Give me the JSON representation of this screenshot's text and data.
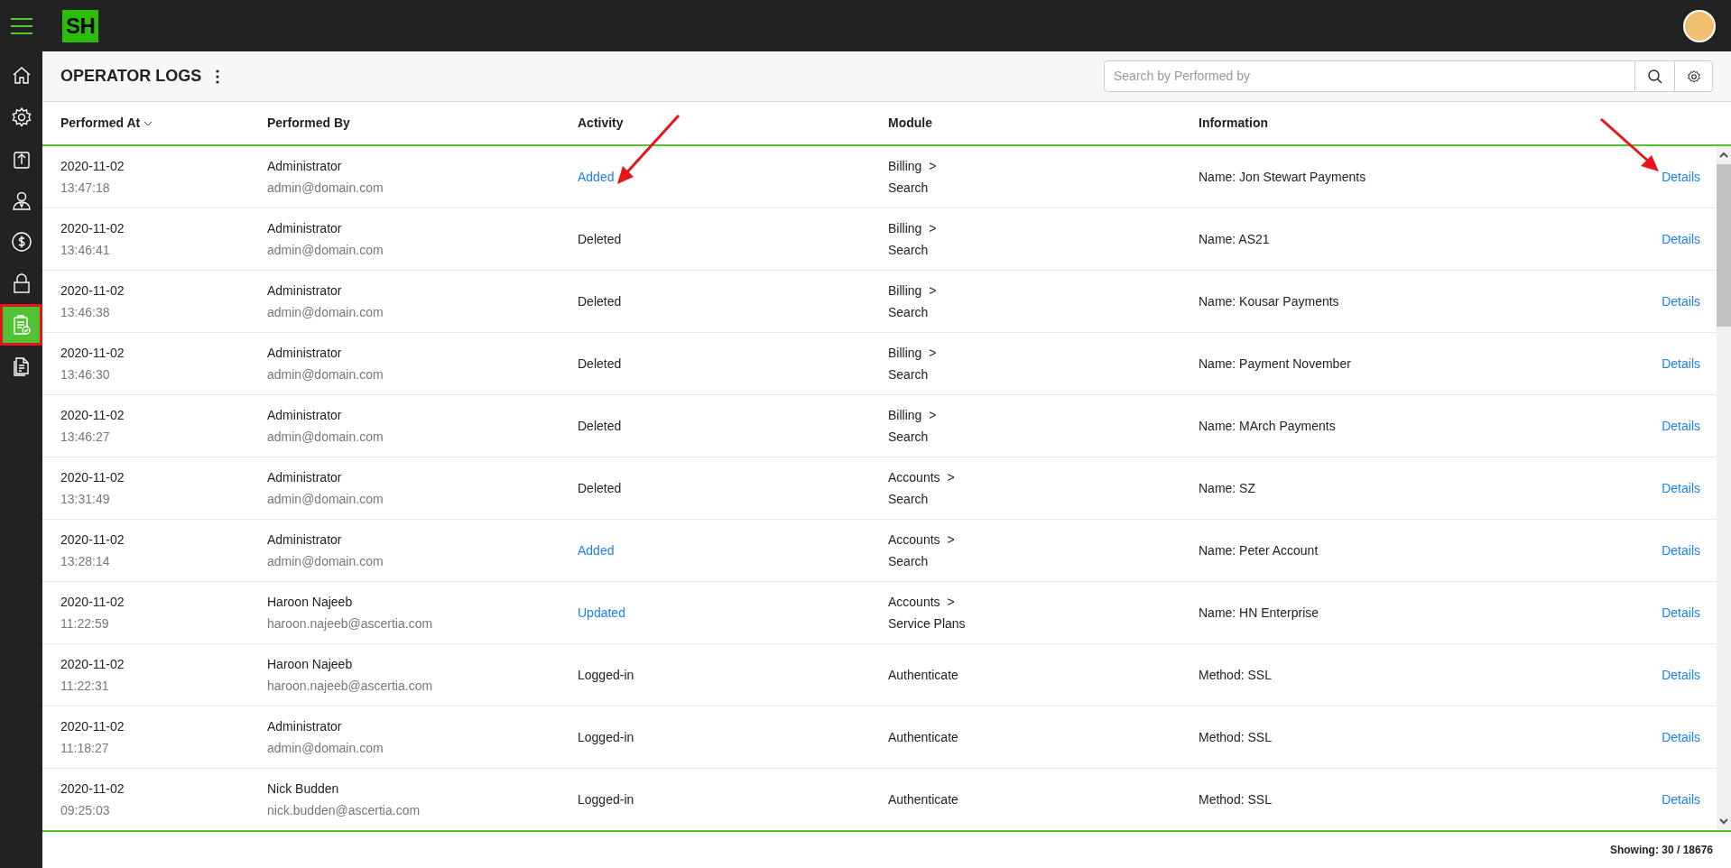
{
  "app": {
    "logo": "SH"
  },
  "sidebar": {
    "items": [
      {
        "kind": "home",
        "selected": false
      },
      {
        "kind": "settings",
        "selected": false
      },
      {
        "kind": "upload",
        "selected": false
      },
      {
        "kind": "user",
        "selected": false
      },
      {
        "kind": "dollar",
        "selected": false
      },
      {
        "kind": "lock",
        "selected": false
      },
      {
        "kind": "clipboard",
        "selected": true
      },
      {
        "kind": "document",
        "selected": false
      }
    ]
  },
  "page": {
    "title": "OPERATOR LOGS",
    "search": {
      "placeholder": "Search by Performed by"
    }
  },
  "table": {
    "columns": [
      {
        "label": "Performed At",
        "sorted": true
      },
      {
        "label": "Performed By",
        "sorted": false
      },
      {
        "label": "Activity",
        "sorted": false
      },
      {
        "label": "Module",
        "sorted": false
      },
      {
        "label": "Information",
        "sorted": false
      }
    ],
    "rows": [
      {
        "date": "2020-11-02",
        "time": "13:47:18",
        "name": "Administrator",
        "email": "admin@domain.com",
        "activity": "Added",
        "activity_link": true,
        "module": "Billing",
        "arrow": ">",
        "submodule": "Search",
        "information": "Name: Jon Stewart Payments",
        "action": "Details"
      },
      {
        "date": "2020-11-02",
        "time": "13:46:41",
        "name": "Administrator",
        "email": "admin@domain.com",
        "activity": "Deleted",
        "activity_link": false,
        "module": "Billing",
        "arrow": ">",
        "submodule": "Search",
        "information": "Name: AS21",
        "action": "Details"
      },
      {
        "date": "2020-11-02",
        "time": "13:46:38",
        "name": "Administrator",
        "email": "admin@domain.com",
        "activity": "Deleted",
        "activity_link": false,
        "module": "Billing",
        "arrow": ">",
        "submodule": "Search",
        "information": "Name: Kousar Payments",
        "action": "Details"
      },
      {
        "date": "2020-11-02",
        "time": "13:46:30",
        "name": "Administrator",
        "email": "admin@domain.com",
        "activity": "Deleted",
        "activity_link": false,
        "module": "Billing",
        "arrow": ">",
        "submodule": "Search",
        "information": "Name: Payment November",
        "action": "Details"
      },
      {
        "date": "2020-11-02",
        "time": "13:46:27",
        "name": "Administrator",
        "email": "admin@domain.com",
        "activity": "Deleted",
        "activity_link": false,
        "module": "Billing",
        "arrow": ">",
        "submodule": "Search",
        "information": "Name: MArch Payments",
        "action": "Details"
      },
      {
        "date": "2020-11-02",
        "time": "13:31:49",
        "name": "Administrator",
        "email": "admin@domain.com",
        "activity": "Deleted",
        "activity_link": false,
        "module": "Accounts",
        "arrow": ">",
        "submodule": "Search",
        "information": "Name: SZ",
        "action": "Details"
      },
      {
        "date": "2020-11-02",
        "time": "13:28:14",
        "name": "Administrator",
        "email": "admin@domain.com",
        "activity": "Added",
        "activity_link": true,
        "module": "Accounts",
        "arrow": ">",
        "submodule": "Search",
        "information": "Name: Peter Account",
        "action": "Details"
      },
      {
        "date": "2020-11-02",
        "time": "11:22:59",
        "name": "Haroon Najeeb",
        "email": "haroon.najeeb@ascertia.com",
        "activity": "Updated",
        "activity_link": true,
        "module": "Accounts",
        "arrow": ">",
        "submodule": "Service Plans",
        "information": "Name: HN Enterprise",
        "action": "Details"
      },
      {
        "date": "2020-11-02",
        "time": "11:22:31",
        "name": "Haroon Najeeb",
        "email": "haroon.najeeb@ascertia.com",
        "activity": "Logged-in",
        "activity_link": false,
        "module": "Authenticate",
        "information": "Method: SSL",
        "action": "Details"
      },
      {
        "date": "2020-11-02",
        "time": "11:18:27",
        "name": "Administrator",
        "email": "admin@domain.com",
        "activity": "Logged-in",
        "activity_link": false,
        "module": "Authenticate",
        "information": "Method: SSL",
        "action": "Details"
      },
      {
        "date": "2020-11-02",
        "time": "09:25:03",
        "name": "Nick Budden",
        "email": "nick.budden@ascertia.com",
        "activity": "Logged-in",
        "activity_link": false,
        "module": "Authenticate",
        "information": "Method: SSL",
        "action": "Details"
      }
    ]
  },
  "footer": {
    "showing": "Showing: 30 / 18676"
  }
}
